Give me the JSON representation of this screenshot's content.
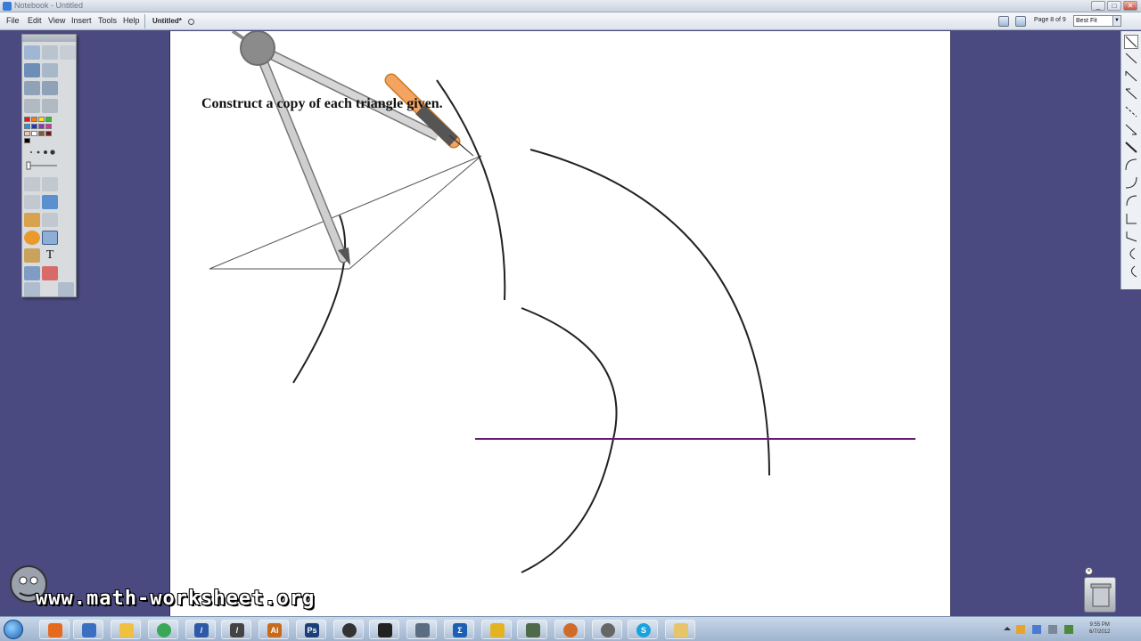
{
  "window": {
    "title": "Notebook - Untitled",
    "minimize_label": "_",
    "maximize_label": "□",
    "close_label": "✕"
  },
  "menubar": {
    "items": [
      "File",
      "Edit",
      "View",
      "Insert",
      "Tools",
      "Help"
    ],
    "document_tab": "Untitled*",
    "page_indicator": "Page 8 of 9",
    "zoom_value": "Best Fit",
    "zoom_arrow": "▼"
  },
  "canvas": {
    "instruction": "Construct a copy of each triangle given."
  },
  "watermark": {
    "text": "www.math-worksheet.org"
  },
  "trash": {
    "close_label": "×"
  },
  "taskbar": {
    "apps": [
      "firefox",
      "sharepoint",
      "mail",
      "notebook",
      "pen",
      "ai",
      "ps",
      "media",
      "tool",
      "search",
      "sigma",
      "geogebra",
      "word",
      "paint",
      "tool2",
      "skype",
      "folder"
    ],
    "app_glyphs": [
      "",
      "",
      "",
      "",
      "/",
      "Ai",
      "Ps",
      "",
      "",
      "",
      "Σ",
      "",
      "",
      "",
      "",
      "S",
      ""
    ],
    "clock_time": "9:55 PM",
    "clock_date": "6/7/2012"
  },
  "colors": {
    "accent_purple": "#6a1b7a",
    "desktop": "#4b4a80",
    "compass_pencil": "#f4a460"
  }
}
